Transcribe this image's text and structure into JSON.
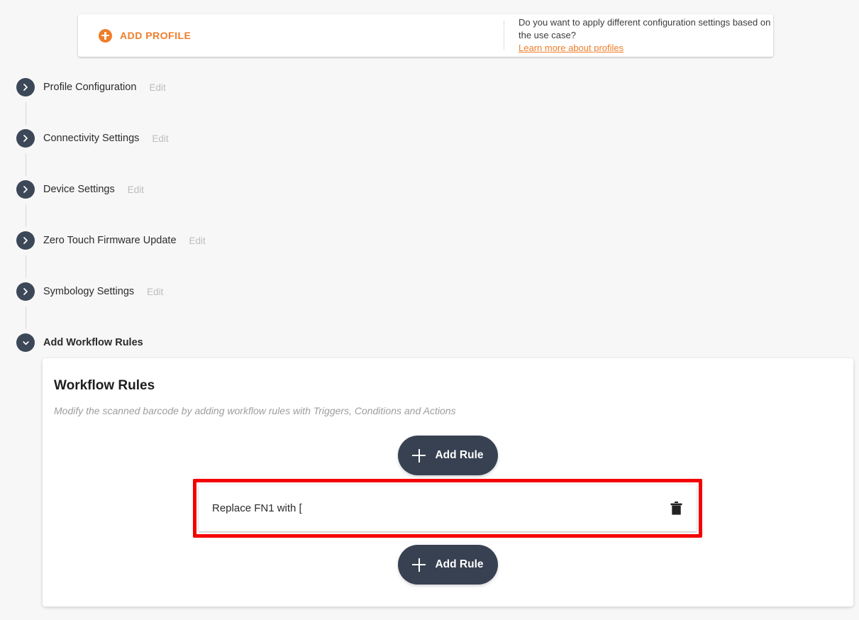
{
  "banner": {
    "add_profile_label": "ADD PROFILE",
    "question": "Do you want to apply different configuration settings based on the use case?",
    "link_label": "Learn more about profiles"
  },
  "stepper": {
    "edit_label": "Edit",
    "items": [
      {
        "title": "Profile Configuration",
        "edit": "Edit",
        "expanded": false,
        "icon": "chevron-right-icon"
      },
      {
        "title": "Connectivity Settings",
        "edit": "Edit",
        "expanded": false,
        "icon": "chevron-right-icon"
      },
      {
        "title": "Device Settings",
        "edit": "Edit",
        "expanded": false,
        "icon": "chevron-right-icon"
      },
      {
        "title": "Zero Touch Firmware Update",
        "edit": "Edit",
        "expanded": false,
        "icon": "chevron-right-icon"
      },
      {
        "title": "Symbology Settings",
        "edit": "Edit",
        "expanded": false,
        "icon": "chevron-right-icon"
      },
      {
        "title": "Add Workflow Rules",
        "edit": "",
        "expanded": true,
        "icon": "chevron-down-icon"
      }
    ]
  },
  "panel": {
    "title": "Workflow Rules",
    "subtitle": "Modify the scanned barcode by adding workflow rules with Triggers, Conditions and Actions",
    "add_rule_top_label": "Add Rule",
    "add_rule_bottom_label": "Add Rule",
    "rules": [
      {
        "text": "Replace FN1 with [",
        "delete_icon": "trash-icon"
      }
    ]
  },
  "colors": {
    "accent_orange": "#ef7d29",
    "dark_slate": "#3c4858",
    "button_slate": "#374151",
    "highlight_red": "#f40000",
    "page_background": "#f7f7f7"
  }
}
